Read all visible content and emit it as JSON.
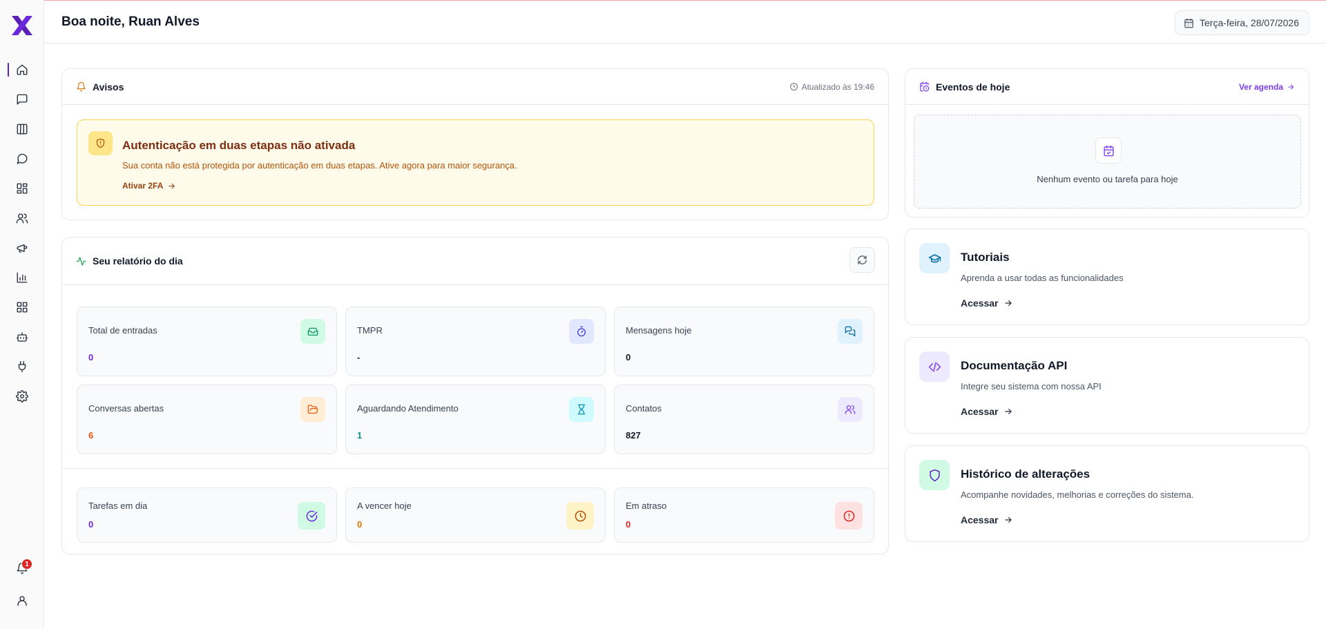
{
  "header": {
    "greeting": "Boa noite, Ruan Alves",
    "date": "Terça-feira, 28/07/2026"
  },
  "sidebar": {
    "items": [
      {
        "icon": "home-icon",
        "active": true
      },
      {
        "icon": "message-square-icon"
      },
      {
        "icon": "kanban-icon"
      },
      {
        "icon": "message-circle-icon"
      },
      {
        "icon": "dashboard-icon"
      },
      {
        "icon": "users-icon"
      },
      {
        "icon": "megaphone-icon"
      },
      {
        "icon": "bar-chart-icon"
      },
      {
        "icon": "apps-grid-icon"
      },
      {
        "icon": "bot-icon"
      },
      {
        "icon": "plug-icon"
      },
      {
        "icon": "gear-icon"
      }
    ],
    "notifications_count": "1"
  },
  "notices": {
    "title": "Avisos",
    "updated": "Atualizado às 19:46",
    "alert": {
      "title": "Autenticação em duas etapas não ativada",
      "text": "Sua conta não está protegida por autenticação em duas etapas. Ative agora para maior segurança.",
      "link": "Ativar 2FA"
    }
  },
  "report": {
    "title": "Seu relatório do dia",
    "stats": [
      {
        "label": "Total de entradas",
        "value": "0",
        "color": "#6d28d9",
        "icon": "inbox-icon",
        "icon_bg": "#d1fae5",
        "icon_color": "#059669"
      },
      {
        "label": "TMPR",
        "value": "-",
        "color": "#111827",
        "icon": "timer-icon",
        "icon_bg": "#e0e7ff",
        "icon_color": "#4338ca"
      },
      {
        "label": "Mensagens hoje",
        "value": "0",
        "color": "#111827",
        "icon": "messages-icon",
        "icon_bg": "#e0f2fe",
        "icon_color": "#0369a1"
      },
      {
        "label": "Conversas abertas",
        "value": "6",
        "color": "#ea580c",
        "icon": "folder-open-icon",
        "icon_bg": "#ffedd5",
        "icon_color": "#ea580c"
      },
      {
        "label": "Aguardando Atendimento",
        "value": "1",
        "color": "#0d9488",
        "icon": "hourglass-icon",
        "icon_bg": "#cffafe",
        "icon_color": "#0891b2"
      },
      {
        "label": "Contatos",
        "value": "827",
        "color": "#111827",
        "icon": "users-icon",
        "icon_bg": "#ede9fe",
        "icon_color": "#7c3aed"
      }
    ],
    "tasks": [
      {
        "label": "Tarefas em dia",
        "value": "0",
        "color": "#6d28d9",
        "icon": "check-circle-icon",
        "icon_bg": "#d1fae5",
        "icon_color": "#6d28d9"
      },
      {
        "label": "A vencer hoje",
        "value": "0",
        "color": "#d97706",
        "icon": "clock-icon",
        "icon_bg": "#fef3c7",
        "icon_color": "#b45309"
      },
      {
        "label": "Em atraso",
        "value": "0",
        "color": "#dc2626",
        "icon": "alert-circle-icon",
        "icon_bg": "#fee2e2",
        "icon_color": "#dc2626"
      }
    ]
  },
  "events": {
    "title": "Eventos de hoje",
    "link": "Ver agenda",
    "empty": "Nenhum evento ou tarefa para hoje"
  },
  "links": [
    {
      "title": "Tutoriais",
      "desc": "Aprenda a usar todas as funcionalidades",
      "action": "Acessar",
      "icon": "graduation-cap-icon",
      "icon_bg": "#e0f2fe",
      "icon_color": "#0369a1"
    },
    {
      "title": "Documentação API",
      "desc": "Integre seu sistema com nossa API",
      "action": "Acessar",
      "icon": "code-icon",
      "icon_bg": "#ede9fe",
      "icon_color": "#7c3aed"
    },
    {
      "title": "Histórico de alterações",
      "desc": "Acompanhe novidades, melhorias e correções do sistema.",
      "action": "Acessar",
      "icon": "shield-icon",
      "icon_bg": "#d1fae5",
      "icon_color": "#5b21b6"
    }
  ]
}
